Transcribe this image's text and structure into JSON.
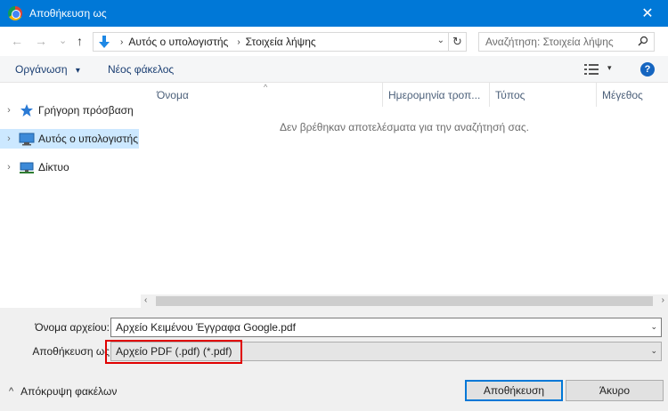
{
  "window": {
    "title": "Αποθήκευση ως",
    "close_glyph": "✕"
  },
  "nav": {
    "back_glyph": "←",
    "forward_glyph": "→",
    "recent_glyph": "⌄",
    "up_glyph": "↑",
    "breadcrumb_sep": "›",
    "breadcrumbs": [
      "Αυτός ο υπολογιστής",
      "Στοιχεία λήψης"
    ],
    "address_dropdown_glyph": "⌄",
    "refresh_glyph": "↻",
    "search_placeholder": "Αναζήτηση: Στοιχεία λήψης",
    "search_icon_glyph": "⚲"
  },
  "toolbar": {
    "organize_label": "Οργάνωση",
    "organize_dropdown_glyph": "▾",
    "new_folder_label": "Νέος φάκελος",
    "view_dropdown_glyph": "▾",
    "help_label": "?"
  },
  "sidebar": {
    "items": [
      {
        "label": "Γρήγορη πρόσβαση",
        "icon": "star-icon",
        "chevron": "›"
      },
      {
        "label": "Αυτός ο υπολογιστής",
        "icon": "computer-icon",
        "chevron": "›"
      },
      {
        "label": "Δίκτυο",
        "icon": "network-icon",
        "chevron": "›"
      }
    ]
  },
  "filelist": {
    "columns": [
      "Όνομα",
      "Ημερομηνία τροπ...",
      "Τύπος",
      "Μέγεθος"
    ],
    "sort_glyph": "^",
    "empty_message": "Δεν βρέθηκαν αποτελέσματα για την αναζήτησή σας.",
    "scroll_left_glyph": "‹",
    "scroll_right_glyph": "›"
  },
  "form": {
    "filename_label": "Όνομα αρχείου:",
    "filename_value": "Αρχείο Κειμένου Έγγραφα Google.pdf",
    "savetype_label": "Αποθήκευση ως",
    "savetype_value": "Αρχείο PDF (.pdf) (*.pdf)",
    "dropdown_glyph": "⌄"
  },
  "footer": {
    "hide_folders_glyph": "^",
    "hide_folders_label": "Απόκρυψη φακέλων",
    "save_label": "Αποθήκευση",
    "cancel_label": "Άκυρο"
  },
  "colors": {
    "titlebar": "#0078d7",
    "selection": "#cce8ff",
    "highlight_box": "#e00000"
  }
}
